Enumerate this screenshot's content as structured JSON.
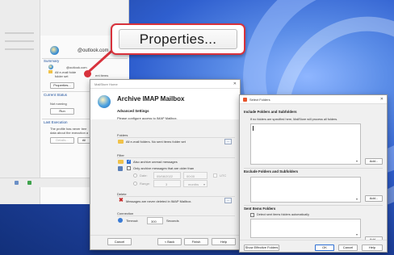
{
  "callout": {
    "text": "Properties..."
  },
  "background_window": {
    "account_email": "@outlook.com",
    "summary_label": "Summary",
    "summary_email": "@outlook.com",
    "summary_line": "All e-mail folders. No sent items folder set",
    "summary_line_a": "All e-mail folde",
    "summary_line_b": "folder set",
    "summary_line_c": "ent items",
    "properties_button": "Properties...",
    "current_status_label": "Current Status",
    "not_running": "Not running",
    "run_button": "Run",
    "last_execution_label": "Last Execution",
    "last_exec_line1": "The profile has never bee",
    "last_exec_line2": "data about the execution a",
    "details_button": "Details...",
    "all_button": "All"
  },
  "archive_dialog": {
    "window_title": "MailStore Home",
    "close_glyph": "✕",
    "title": "Archive IMAP Mailbox",
    "advanced_settings": "Advanced Settings",
    "configure_text": "Please configure access to IMAP Mailbox.",
    "folders_label": "Folders",
    "folders_value": "All e-mail folders. No sent items folder set",
    "browse_button": "...",
    "filter_label": "Filter",
    "also_archive_unread": "Also archive unread messages",
    "also_archive_unread_checked": true,
    "only_archive_older": "Only archive messages that are older than",
    "only_archive_older_checked": false,
    "date_label": "Date:",
    "date_value": "05/08/2022",
    "time_value": "00:00",
    "utc_label": "UTC",
    "range_label": "Range:",
    "range_value": "3",
    "range_unit": "months",
    "delete_label": "Delete",
    "delete_value": "Messages are never deleted in IMAP Mailbox.",
    "connection_label": "Connection",
    "timeout_label": "Timeout:",
    "timeout_value": "300",
    "timeout_unit": "Seconds",
    "cancel_button": "Cancel",
    "back_button": "< Back",
    "finish_button": "Finish",
    "help_button": "Help"
  },
  "select_folders_dialog": {
    "window_title": "Select Folders",
    "close_glyph": "✕",
    "include_header": "Include Folders and Subfolders",
    "include_hint": "If no folders are specified here, MailStore will process all folders.",
    "add_button_1": "Add...",
    "exclude_header": "Exclude Folders and Subfolders",
    "add_button_2": "Add...",
    "sent_header": "Sent Items Folders",
    "detect_sent": "Detect sent items folders automatically",
    "detect_sent_checked": false,
    "add_button_3": "Add...",
    "show_effective_button": "Show Effective Folders",
    "ok_button": "OK",
    "cancel_button": "Cancel",
    "help_button": "Help"
  },
  "colors": {
    "callout_red": "#d8323c",
    "accent_blue": "#2f6fd3",
    "folder_yellow": "#f0c24a"
  }
}
